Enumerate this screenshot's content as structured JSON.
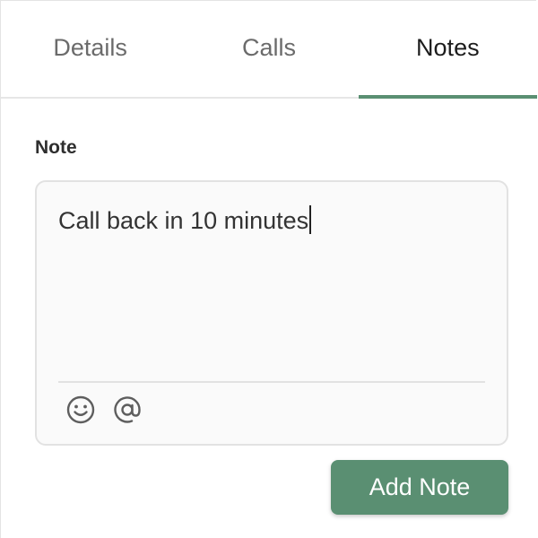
{
  "tabs": [
    {
      "label": "Details",
      "active": false
    },
    {
      "label": "Calls",
      "active": false
    },
    {
      "label": "Notes",
      "active": true
    }
  ],
  "note": {
    "label": "Note",
    "value": "Call back in 10 minutes"
  },
  "toolbar": {
    "icons": [
      "emoji-smile-icon",
      "at-mention-icon"
    ]
  },
  "actions": {
    "add_note_label": "Add Note"
  },
  "colors": {
    "accent": "#5a8f72"
  }
}
